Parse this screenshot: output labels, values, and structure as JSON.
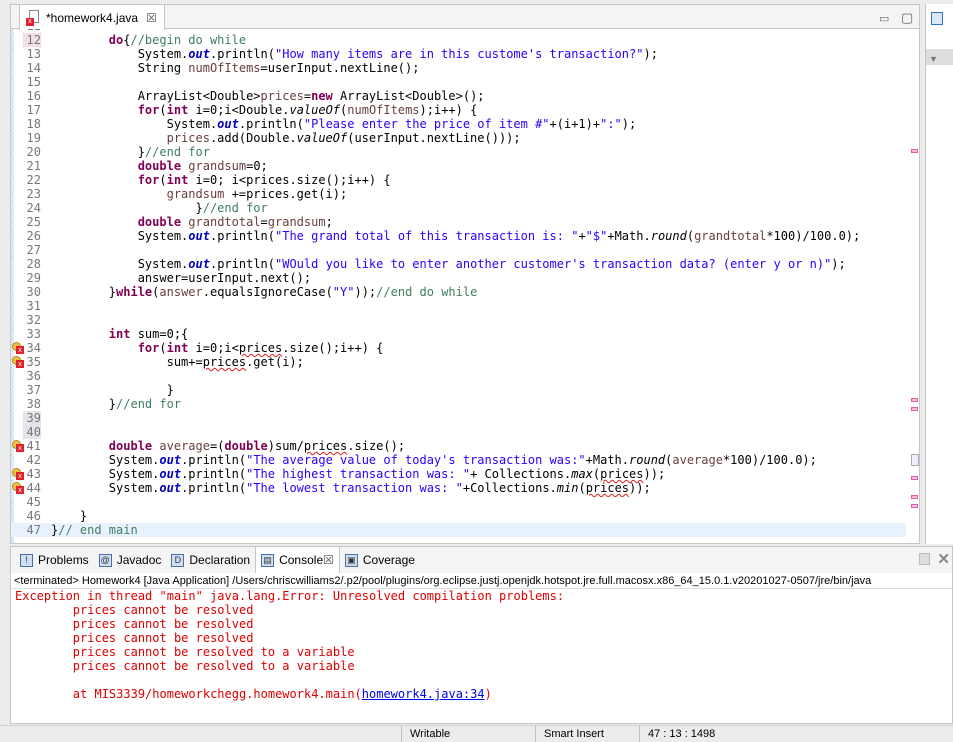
{
  "editor": {
    "tab_title": "*homework4.java",
    "colors": {
      "keyword": "#7f0055",
      "string": "#2a00ff",
      "comment": "#3f7f5f",
      "field": "#0000c0",
      "error": "#e02020"
    },
    "lines": [
      {
        "n": "11",
        "t": []
      },
      {
        "n": "12",
        "t": [
          [
            "p",
            "        "
          ],
          [
            "k",
            "do"
          ],
          [
            "p",
            "{"
          ],
          [
            "c",
            "//begin do while"
          ]
        ]
      },
      {
        "n": "13",
        "t": [
          [
            "p",
            "            System."
          ],
          [
            "f",
            "out"
          ],
          [
            "p",
            ".println("
          ],
          [
            "s",
            "\"How many items are in this custome's transaction?\""
          ],
          [
            "p",
            ");"
          ]
        ]
      },
      {
        "n": "14",
        "t": [
          [
            "p",
            "            String "
          ],
          [
            "v",
            "numOfItems"
          ],
          [
            "p",
            "=userInput.nextLine();"
          ]
        ]
      },
      {
        "n": "15",
        "t": []
      },
      {
        "n": "16",
        "t": [
          [
            "p",
            "            ArrayList<Double>"
          ],
          [
            "v",
            "prices"
          ],
          [
            "p",
            "="
          ],
          [
            "k",
            "new"
          ],
          [
            "p",
            " ArrayList<Double>();"
          ]
        ]
      },
      {
        "n": "17",
        "t": [
          [
            "p",
            "            "
          ],
          [
            "k",
            "for"
          ],
          [
            "p",
            "("
          ],
          [
            "k",
            "int"
          ],
          [
            "p",
            " i=0;i<Double."
          ],
          [
            "m",
            "valueOf"
          ],
          [
            "p",
            "("
          ],
          [
            "v",
            "numOfItems"
          ],
          [
            "p",
            ");i++) {"
          ]
        ]
      },
      {
        "n": "18",
        "t": [
          [
            "p",
            "                System."
          ],
          [
            "f",
            "out"
          ],
          [
            "p",
            ".println("
          ],
          [
            "s",
            "\"Please enter the price of item #\""
          ],
          [
            "p",
            "+(i+1)+"
          ],
          [
            "s",
            "\":\""
          ],
          [
            "p",
            ");"
          ]
        ]
      },
      {
        "n": "19",
        "t": [
          [
            "p",
            "                "
          ],
          [
            "v",
            "prices"
          ],
          [
            "p",
            ".add(Double."
          ],
          [
            "m",
            "valueOf"
          ],
          [
            "p",
            "(userInput.nextLine()));"
          ]
        ]
      },
      {
        "n": "20",
        "t": [
          [
            "p",
            "            }"
          ],
          [
            "c",
            "//end for"
          ]
        ]
      },
      {
        "n": "21",
        "t": [
          [
            "p",
            "            "
          ],
          [
            "k",
            "double"
          ],
          [
            "p",
            " "
          ],
          [
            "v",
            "grandsum"
          ],
          [
            "p",
            "=0;"
          ]
        ]
      },
      {
        "n": "22",
        "t": [
          [
            "p",
            "            "
          ],
          [
            "k",
            "for"
          ],
          [
            "p",
            "("
          ],
          [
            "k",
            "int"
          ],
          [
            "p",
            " i=0; i<prices.size();i++) {"
          ]
        ]
      },
      {
        "n": "23",
        "t": [
          [
            "p",
            "                "
          ],
          [
            "v",
            "grandsum"
          ],
          [
            "p",
            " +=prices.get(i);"
          ]
        ]
      },
      {
        "n": "24",
        "t": [
          [
            "p",
            "                    }"
          ],
          [
            "c",
            "//end for"
          ]
        ]
      },
      {
        "n": "25",
        "t": [
          [
            "p",
            "            "
          ],
          [
            "k",
            "double"
          ],
          [
            "p",
            " "
          ],
          [
            "v",
            "grandtotal"
          ],
          [
            "p",
            "="
          ],
          [
            "v",
            "grandsum"
          ],
          [
            "p",
            ";"
          ]
        ]
      },
      {
        "n": "26",
        "t": [
          [
            "p",
            "            System."
          ],
          [
            "f",
            "out"
          ],
          [
            "p",
            ".println("
          ],
          [
            "s",
            "\"The grand total of this transaction is: \""
          ],
          [
            "p",
            "+"
          ],
          [
            "s",
            "\"$\""
          ],
          [
            "p",
            "+Math."
          ],
          [
            "m",
            "round"
          ],
          [
            "p",
            "("
          ],
          [
            "v",
            "grandtotal"
          ],
          [
            "p",
            "*100)/100.0);"
          ]
        ]
      },
      {
        "n": "27",
        "t": []
      },
      {
        "n": "28",
        "t": [
          [
            "p",
            "            System."
          ],
          [
            "f",
            "out"
          ],
          [
            "p",
            ".println("
          ],
          [
            "s",
            "\"WOuld you like to enter another customer's transaction data? (enter y or n)\""
          ],
          [
            "p",
            ");"
          ]
        ]
      },
      {
        "n": "29",
        "t": [
          [
            "p",
            "            answer=userInput.next();"
          ]
        ]
      },
      {
        "n": "30",
        "t": [
          [
            "p",
            "        }"
          ],
          [
            "k",
            "while"
          ],
          [
            "p",
            "("
          ],
          [
            "v",
            "answer"
          ],
          [
            "p",
            ".equalsIgnoreCase("
          ],
          [
            "s",
            "\"Y\""
          ],
          [
            "p",
            "));"
          ],
          [
            "c",
            "//end do while"
          ]
        ]
      },
      {
        "n": "31",
        "t": []
      },
      {
        "n": "32",
        "t": []
      },
      {
        "n": "33",
        "t": [
          [
            "p",
            "        "
          ],
          [
            "k",
            "int"
          ],
          [
            "p",
            " sum=0;{"
          ]
        ]
      },
      {
        "n": "34",
        "err": true,
        "t": [
          [
            "p",
            "            "
          ],
          [
            "k",
            "for"
          ],
          [
            "p",
            "("
          ],
          [
            "k",
            "int"
          ],
          [
            "p",
            " i=0;i<"
          ],
          [
            "e",
            "prices"
          ],
          [
            "p",
            ".size();i++) {"
          ]
        ]
      },
      {
        "n": "35",
        "err": true,
        "t": [
          [
            "p",
            "                sum+="
          ],
          [
            "e",
            "prices"
          ],
          [
            "p",
            ".get(i);"
          ]
        ]
      },
      {
        "n": "36",
        "t": []
      },
      {
        "n": "37",
        "t": [
          [
            "p",
            "                }"
          ]
        ]
      },
      {
        "n": "38",
        "t": [
          [
            "p",
            "        }"
          ],
          [
            "c",
            "//end for"
          ]
        ]
      },
      {
        "n": "39",
        "t": []
      },
      {
        "n": "40",
        "t": []
      },
      {
        "n": "41",
        "err": true,
        "t": [
          [
            "p",
            "        "
          ],
          [
            "k",
            "double"
          ],
          [
            "p",
            " "
          ],
          [
            "v",
            "average"
          ],
          [
            "p",
            "=("
          ],
          [
            "k",
            "double"
          ],
          [
            "p",
            ")sum/"
          ],
          [
            "e",
            "prices"
          ],
          [
            "p",
            ".size();"
          ]
        ]
      },
      {
        "n": "42",
        "t": [
          [
            "p",
            "        System."
          ],
          [
            "f",
            "out"
          ],
          [
            "p",
            ".println("
          ],
          [
            "s",
            "\"The average value of today's transaction was:\""
          ],
          [
            "p",
            "+Math."
          ],
          [
            "m",
            "round"
          ],
          [
            "p",
            "("
          ],
          [
            "v",
            "average"
          ],
          [
            "p",
            "*100)/100.0);"
          ]
        ]
      },
      {
        "n": "43",
        "err": true,
        "t": [
          [
            "p",
            "        System."
          ],
          [
            "f",
            "out"
          ],
          [
            "p",
            ".println("
          ],
          [
            "s",
            "\"The highest transaction was: \""
          ],
          [
            "p",
            "+ Collections."
          ],
          [
            "m",
            "max"
          ],
          [
            "p",
            "("
          ],
          [
            "e",
            "prices"
          ],
          [
            "p",
            "));"
          ]
        ]
      },
      {
        "n": "44",
        "err": true,
        "t": [
          [
            "p",
            "        System."
          ],
          [
            "f",
            "out"
          ],
          [
            "p",
            ".println("
          ],
          [
            "s",
            "\"The lowest transaction was: \""
          ],
          [
            "p",
            "+Collections."
          ],
          [
            "m",
            "min"
          ],
          [
            "p",
            "("
          ],
          [
            "e",
            "prices"
          ],
          [
            "p",
            "));"
          ]
        ]
      },
      {
        "n": "45",
        "t": []
      },
      {
        "n": "46",
        "t": [
          [
            "p",
            "    }"
          ]
        ]
      },
      {
        "n": "47",
        "t": [
          [
            "p",
            "}"
          ],
          [
            "c",
            "// end main"
          ]
        ]
      }
    ]
  },
  "bottom": {
    "tabs": [
      {
        "label": "Problems",
        "icon": "problems-icon"
      },
      {
        "label": "Javadoc",
        "icon": "at-icon"
      },
      {
        "label": "Declaration",
        "icon": "declaration-icon"
      },
      {
        "label": "Console",
        "icon": "console-icon",
        "active": true
      },
      {
        "label": "Coverage",
        "icon": "coverage-icon"
      }
    ],
    "terminated": "<terminated> Homework4 [Java Application] /Users/chriscwilliams2/.p2/pool/plugins/org.eclipse.justj.openjdk.hotspot.jre.full.macosx.x86_64_15.0.1.v20201027-0507/jre/bin/java",
    "console": {
      "l0": "Exception in thread \"main\" java.lang.Error: Unresolved compilation problems: ",
      "l1": "\tprices cannot be resolved",
      "l2": "\tprices cannot be resolved",
      "l3": "\tprices cannot be resolved",
      "l4": "\tprices cannot be resolved to a variable",
      "l5": "\tprices cannot be resolved to a variable",
      "l7a": "\tat MIS3339/homeworkchegg.homework4.main(",
      "l7link": "homework4.java:34",
      "l7b": ")"
    },
    "console_color": "#e00000"
  },
  "status": {
    "writable": "Writable",
    "insert": "Smart Insert",
    "position": "47 : 13 : 1498"
  }
}
